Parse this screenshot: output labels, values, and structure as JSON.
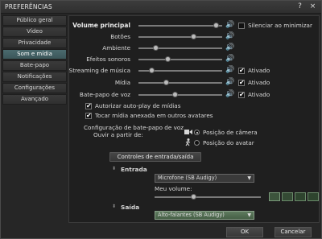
{
  "window": {
    "title": "PREFERÊNCIAS",
    "help_glyph": "?",
    "close_glyph": "×"
  },
  "sidebar": {
    "items": [
      {
        "label": "Público geral"
      },
      {
        "label": "Vídeo"
      },
      {
        "label": "Privacidade"
      },
      {
        "label": "Som e mídia",
        "active": true
      },
      {
        "label": "Bate-papo"
      },
      {
        "label": "Notificações"
      },
      {
        "label": "Configurações"
      },
      {
        "label": "Avançado"
      }
    ]
  },
  "audio": {
    "master": {
      "label": "Volume principal",
      "level": 0.92
    },
    "mute_all": {
      "label": "Silenciar ao minimizar",
      "checked": false
    },
    "rows": [
      {
        "label": "Botões",
        "level": 0.65
      },
      {
        "label": "Ambiente",
        "level": 0.2
      },
      {
        "label": "Efeitos sonoros",
        "level": 0.35
      },
      {
        "label": "Streaming de música",
        "level": 0.15,
        "enabled_label": "Ativado",
        "enabled": true
      },
      {
        "label": "Mídia",
        "level": 0.33,
        "enabled_label": "Ativado",
        "enabled": true
      },
      {
        "label": "Bate-papo de voz",
        "level": 0.43,
        "enabled_label": "Ativado",
        "enabled": true
      }
    ],
    "auto_play": {
      "label": "Autorizar auto-play de mídias",
      "checked": true
    },
    "attached_media": {
      "label": "Tocar mídia anexada em outros avatares",
      "checked": true
    }
  },
  "voice": {
    "section_label": "Configuração de bate-papo de voz",
    "hear_from_label": "Ouvir a partir de:",
    "option_camera": "Posição de câmera",
    "option_avatar": "Posição do avatar",
    "selected": "camera",
    "controls_button": "Controles de entrada/saída",
    "input_label": "Entrada",
    "input_device": "Microfone (SB Audigy)",
    "volume_label": "Meu volume:",
    "volume_level": 0.36,
    "output_label": "Saída",
    "output_device": "Alto-falantes (SB Audigy)"
  },
  "footer": {
    "ok": "OK",
    "cancel": "Cancelar"
  },
  "icons": {
    "speaker": "speaker-icon",
    "camera": "camera-icon",
    "walk": "walking-person-icon"
  }
}
